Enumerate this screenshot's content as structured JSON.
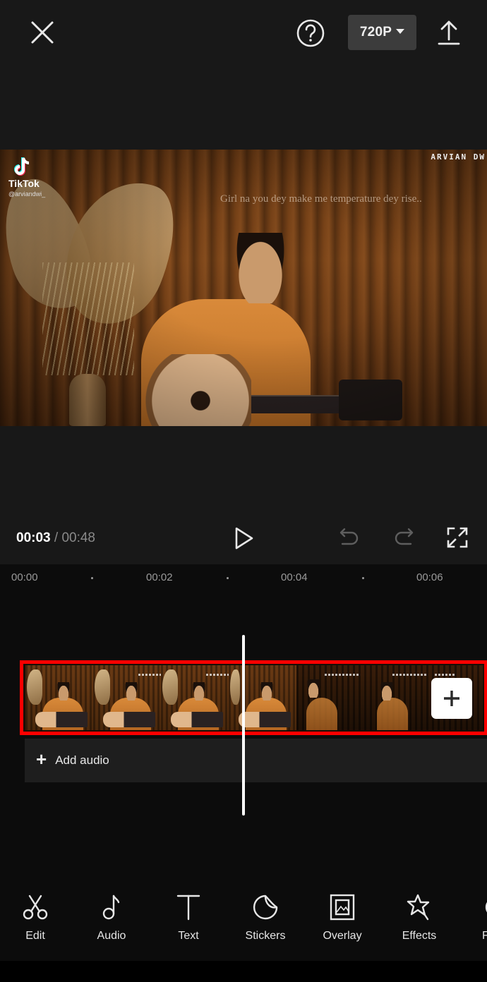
{
  "header": {
    "close_icon": "close-icon",
    "help_icon": "help-circle-icon",
    "resolution": {
      "label": "720P",
      "icon": "caret-down-icon"
    },
    "export_icon": "upload-icon"
  },
  "preview": {
    "overlay": {
      "tiktok_brand": "TikTok",
      "tiktok_handle": "@arviandwi_",
      "watermark": "ARVIAN DW",
      "lyric": "Girl na you dey make me temperature dey rise.."
    }
  },
  "transport": {
    "current_time": "00:03",
    "separator": " / ",
    "total_time": "00:48",
    "play_icon": "play-icon",
    "undo_icon": "undo-icon",
    "redo_icon": "redo-icon",
    "fullscreen_icon": "fullscreen-icon"
  },
  "timeline": {
    "ruler": [
      "00:00",
      "00:02",
      "00:04",
      "00:06"
    ],
    "clip_track": {
      "highlighted": true,
      "highlight_color": "#ff0000",
      "add_clip_icon": "plus-icon"
    },
    "audio_track": {
      "icon": "plus-icon",
      "label": "Add audio"
    },
    "playhead_time": "00:03"
  },
  "toolbar": {
    "items": [
      {
        "label": "Edit",
        "icon": "scissors-icon"
      },
      {
        "label": "Audio",
        "icon": "music-note-icon"
      },
      {
        "label": "Text",
        "icon": "text-icon"
      },
      {
        "label": "Stickers",
        "icon": "sticker-icon"
      },
      {
        "label": "Overlay",
        "icon": "overlay-image-icon"
      },
      {
        "label": "Effects",
        "icon": "star-wand-icon"
      },
      {
        "label": "F",
        "icon": "filter-icon"
      }
    ]
  }
}
